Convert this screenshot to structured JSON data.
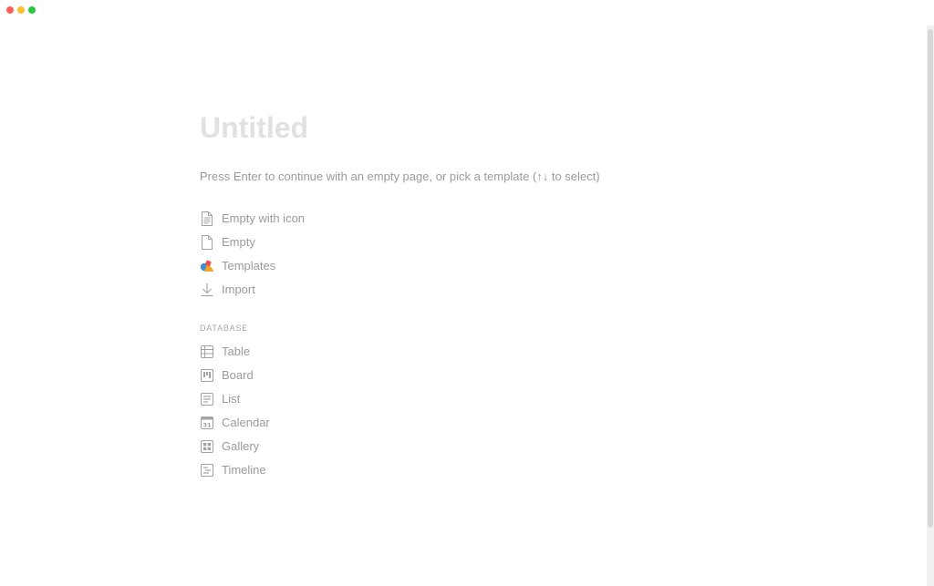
{
  "window": {
    "colors": {
      "close": "#ff5f57",
      "minimize": "#febc2e",
      "zoom": "#28c840"
    }
  },
  "page": {
    "title": "Untitled",
    "hint": "Press Enter to continue with an empty page, or pick a template (↑↓ to select)"
  },
  "menu": {
    "items": [
      {
        "label": "Empty with icon",
        "icon": "page-with-icon-icon"
      },
      {
        "label": "Empty",
        "icon": "page-icon"
      },
      {
        "label": "Templates",
        "icon": "templates-icon"
      },
      {
        "label": "Import",
        "icon": "import-arrow-icon"
      }
    ]
  },
  "database": {
    "heading": "DATABASE",
    "items": [
      {
        "label": "Table",
        "icon": "table-icon"
      },
      {
        "label": "Board",
        "icon": "board-icon"
      },
      {
        "label": "List",
        "icon": "list-icon"
      },
      {
        "label": "Calendar",
        "icon": "calendar-icon",
        "calendar_day": "31"
      },
      {
        "label": "Gallery",
        "icon": "gallery-icon"
      },
      {
        "label": "Timeline",
        "icon": "timeline-icon"
      }
    ]
  },
  "colors": {
    "title": "#e1e1e0",
    "text": "#9b9a97",
    "icon": "#a3a29f"
  }
}
